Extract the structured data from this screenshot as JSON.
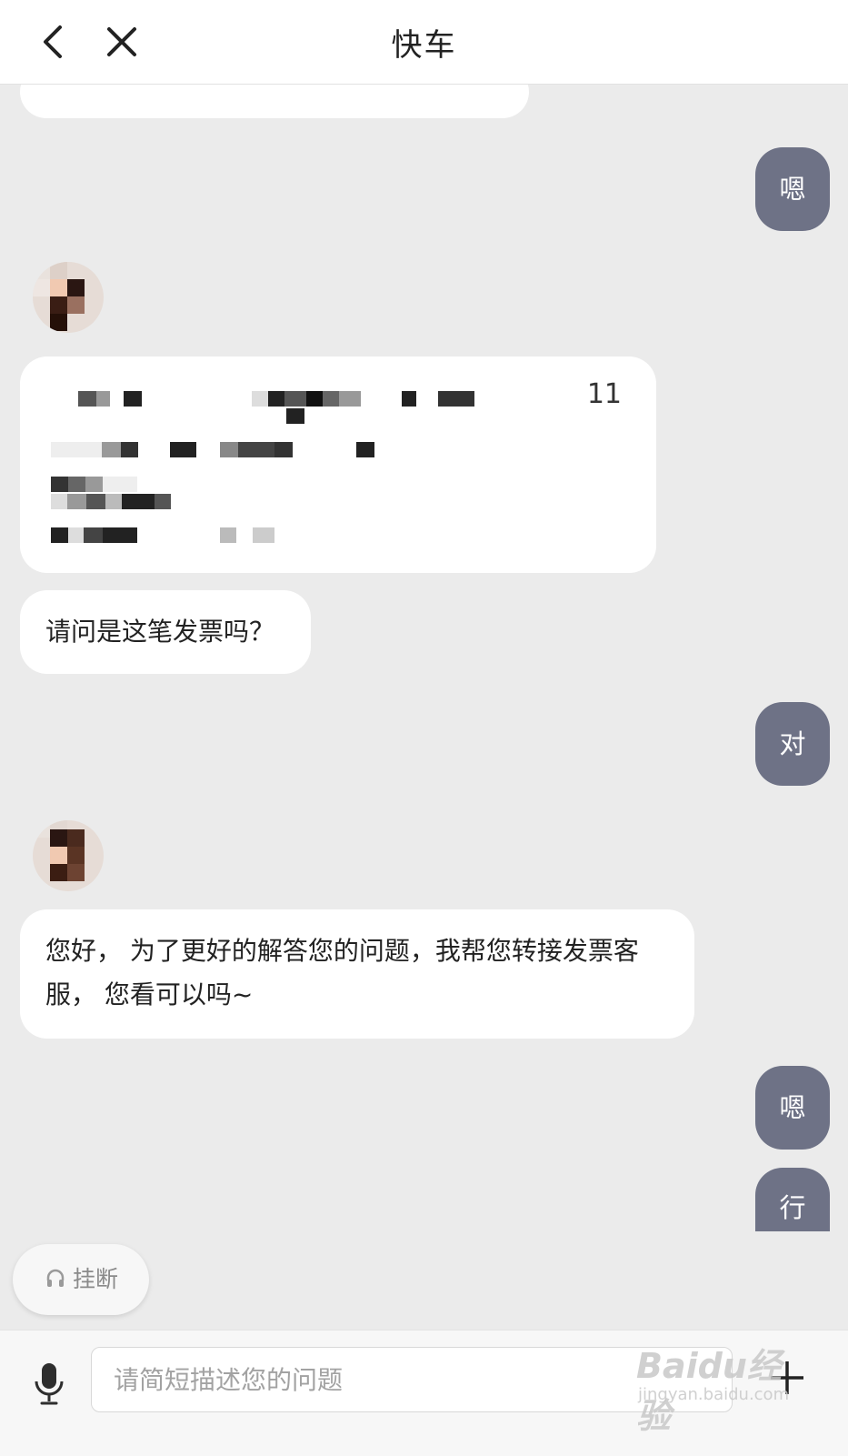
{
  "header": {
    "title": "快车"
  },
  "messages": {
    "agent_invoice_question": "请问是这笔发票吗？",
    "agent_transfer": "您好， 为了更好的解答您的问题，我帮您转接发票客服， 您看可以吗~",
    "user_1": "嗯",
    "user_2": "对",
    "user_3": "嗯",
    "user_4": "行",
    "card_time_visible": "11"
  },
  "actions": {
    "hangup_label": "挂断"
  },
  "input": {
    "placeholder": "请简短描述您的问题"
  },
  "watermark": {
    "line1": "Baidu经验",
    "line2": "jingyan.baidu.com"
  },
  "colors": {
    "user_bubble": "#6e7286",
    "background": "#ebebeb"
  }
}
